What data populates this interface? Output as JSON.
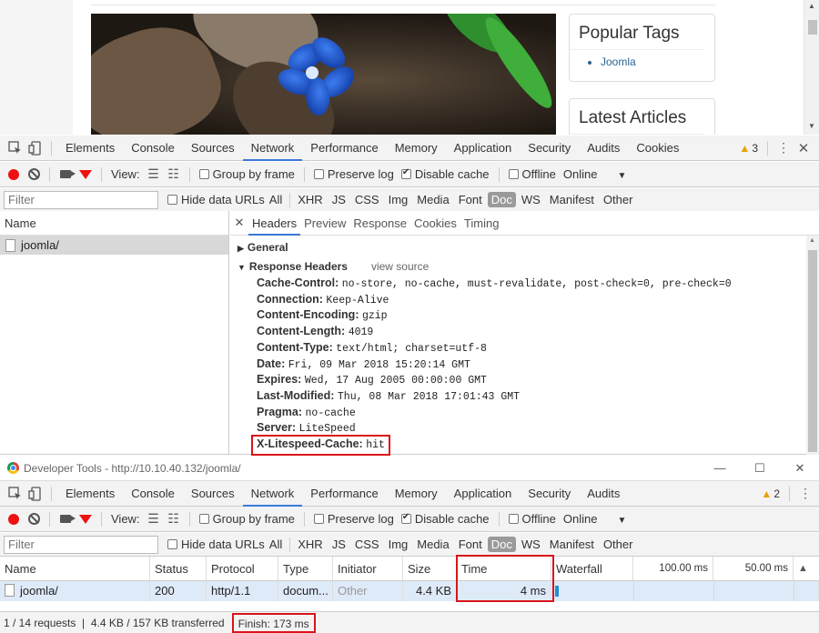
{
  "webpage": {
    "widgets": [
      {
        "title": "Popular Tags",
        "items": [
          "Joomla"
        ]
      },
      {
        "title": "Latest Articles",
        "items": []
      }
    ]
  },
  "devtools1": {
    "tabs": [
      "Elements",
      "Console",
      "Sources",
      "Network",
      "Performance",
      "Memory",
      "Application",
      "Security",
      "Audits",
      "Cookies"
    ],
    "active_tab": "Network",
    "warning_count": "3",
    "controls": {
      "view_label": "View:",
      "group_by_frame": "Group by frame",
      "preserve_log": "Preserve log",
      "disable_cache": "Disable cache",
      "offline": "Offline",
      "throttle": "Online"
    },
    "filter": {
      "placeholder": "Filter",
      "hide_data_urls": "Hide data URLs",
      "types": [
        "All",
        "XHR",
        "JS",
        "CSS",
        "Img",
        "Media",
        "Font",
        "Doc",
        "WS",
        "Manifest",
        "Other"
      ],
      "active_type": "Doc"
    },
    "request_list": {
      "header": "Name",
      "rows": [
        "joomla/"
      ]
    },
    "detail_tabs": [
      "Headers",
      "Preview",
      "Response",
      "Cookies",
      "Timing"
    ],
    "sections": {
      "general": "General",
      "response_headers": "Response Headers",
      "view_source": "view source"
    },
    "headers": [
      {
        "name": "Cache-Control:",
        "value": "no-store, no-cache, must-revalidate, post-check=0, pre-check=0"
      },
      {
        "name": "Connection:",
        "value": "Keep-Alive"
      },
      {
        "name": "Content-Encoding:",
        "value": "gzip"
      },
      {
        "name": "Content-Length:",
        "value": "4019"
      },
      {
        "name": "Content-Type:",
        "value": "text/html; charset=utf-8"
      },
      {
        "name": "Date:",
        "value": "Fri, 09 Mar 2018 15:20:14 GMT"
      },
      {
        "name": "Expires:",
        "value": "Wed, 17 Aug 2005 00:00:00 GMT"
      },
      {
        "name": "Last-Modified:",
        "value": "Thu, 08 Mar 2018 17:01:43 GMT"
      },
      {
        "name": "Pragma:",
        "value": "no-cache"
      },
      {
        "name": "Server:",
        "value": "LiteSpeed"
      },
      {
        "name": "X-Litespeed-Cache:",
        "value": "hit"
      }
    ]
  },
  "devtools2": {
    "window_title": "Developer Tools - http://10.10.40.132/joomla/",
    "tabs": [
      "Elements",
      "Console",
      "Sources",
      "Network",
      "Performance",
      "Memory",
      "Application",
      "Security",
      "Audits"
    ],
    "active_tab": "Network",
    "warning_count": "2",
    "table": {
      "columns": [
        "Name",
        "Status",
        "Protocol",
        "Type",
        "Initiator",
        "Size",
        "Time",
        "Waterfall",
        "100.00 ms",
        "50.00 ms"
      ],
      "row": {
        "name": "joomla/",
        "status": "200",
        "protocol": "http/1.1",
        "type": "docum...",
        "initiator": "Other",
        "size": "4.4 KB",
        "time": "4 ms"
      }
    },
    "status": {
      "summary": "1 / 14 requests  |  4.4 KB / 157 KB transferred",
      "finish": "Finish: 173 ms"
    }
  },
  "colors": {
    "accent": "#3879d9",
    "highlight": "#d9141b",
    "record": "#e11111"
  }
}
